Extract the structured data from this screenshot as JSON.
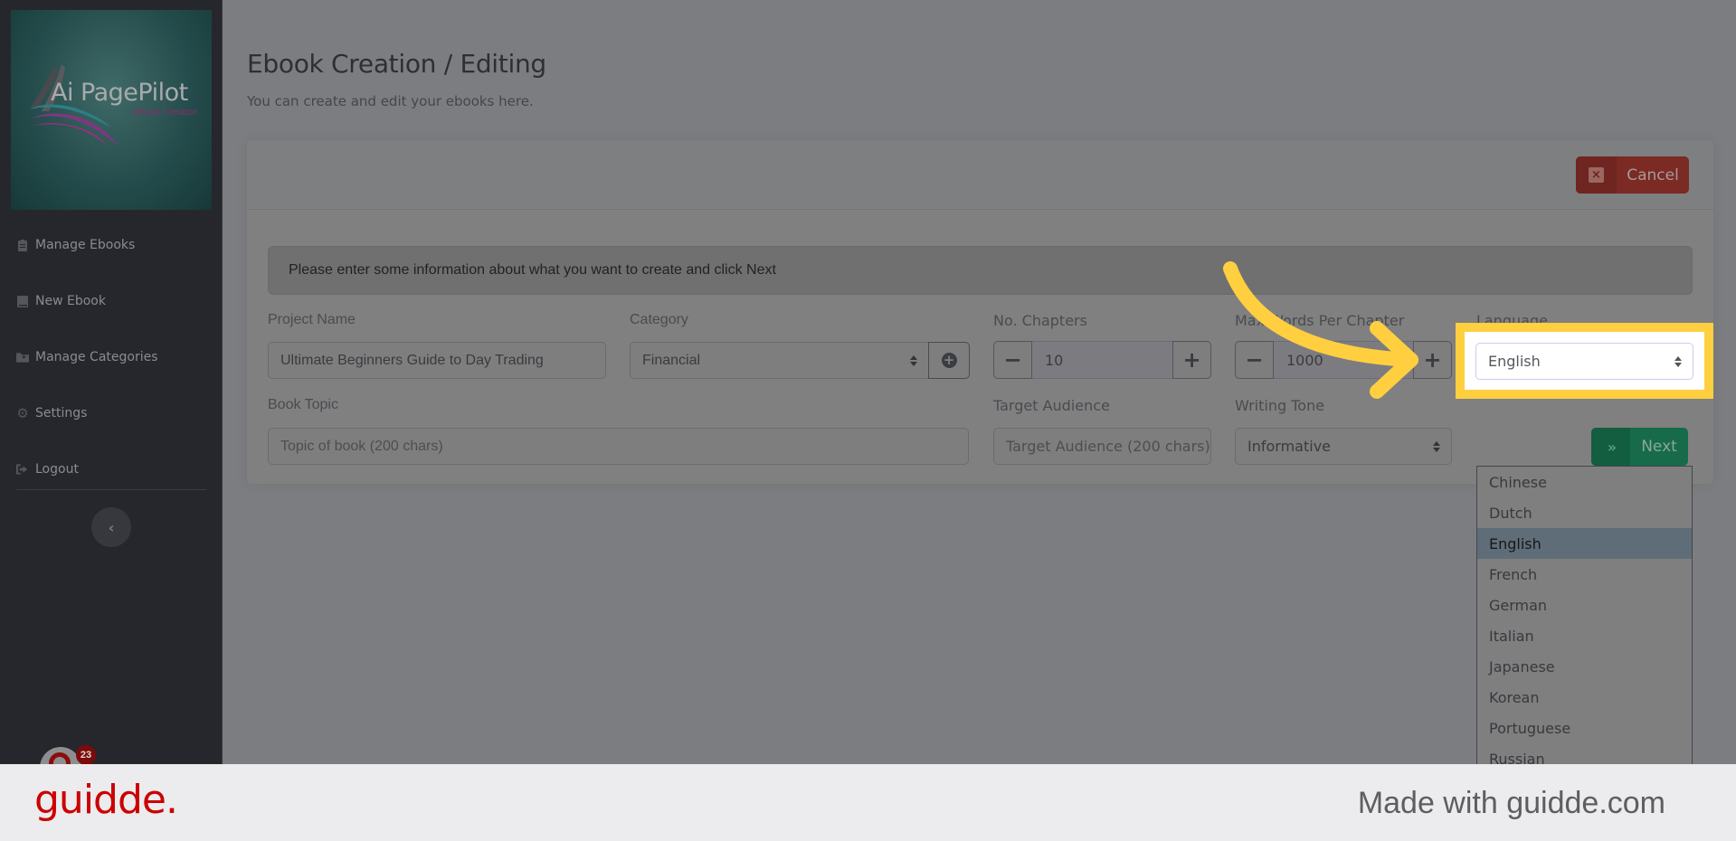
{
  "sidebar": {
    "logo": {
      "title": "Ai PagePilot",
      "subtitle": "eBook Creator."
    },
    "items": [
      {
        "label": "Manage Ebooks",
        "icon": "clipboard-list-icon"
      },
      {
        "label": "New Ebook",
        "icon": "book-icon"
      },
      {
        "label": "Manage Categories",
        "icon": "folder-plus-icon"
      },
      {
        "label": "Settings",
        "icon": "gear-icon"
      },
      {
        "label": "Logout",
        "icon": "sign-out-icon"
      }
    ],
    "collapse_icon": "chevron-left-icon",
    "chat_widget": {
      "badge_count": "23"
    }
  },
  "header": {
    "title": "Ebook Creation / Editing",
    "subtitle": "You can create and edit your ebooks here."
  },
  "card": {
    "cancel_label": "Cancel",
    "alert_text": "Please enter some information about what you want to create and click Next",
    "fields": {
      "project_name": {
        "label": "Project Name",
        "value": "Ultimate Beginners Guide to Day Trading"
      },
      "category": {
        "label": "Category",
        "value": "Financial"
      },
      "chapters": {
        "label": "No. Chapters",
        "value": "10",
        "minus": "−",
        "plus": "+"
      },
      "max_words": {
        "label": "Max Words Per Chapter",
        "value": "1000",
        "minus": "−",
        "plus": "+"
      },
      "language": {
        "label": "Language",
        "value": "English"
      },
      "book_topic": {
        "label": "Book Topic",
        "placeholder": "Topic of book (200 chars)"
      },
      "target_audience": {
        "label": "Target Audience",
        "placeholder": "Target Audience (200 chars)"
      },
      "writing_tone": {
        "label": "Writing Tone",
        "value": "Informative"
      }
    },
    "next_label": "Next",
    "next_icon": "double-chevron-right-icon"
  },
  "language_dropdown": {
    "selected": "English",
    "options": [
      "Chinese",
      "Dutch",
      "English",
      "French",
      "German",
      "Italian",
      "Japanese",
      "Korean",
      "Portuguese",
      "Russian"
    ]
  },
  "annotation": {
    "highlight_color": "#ffcf40"
  },
  "footer": {
    "brand": "guidde.",
    "made_with": "Made with guidde.com",
    "brand_color": "#cc0000"
  }
}
